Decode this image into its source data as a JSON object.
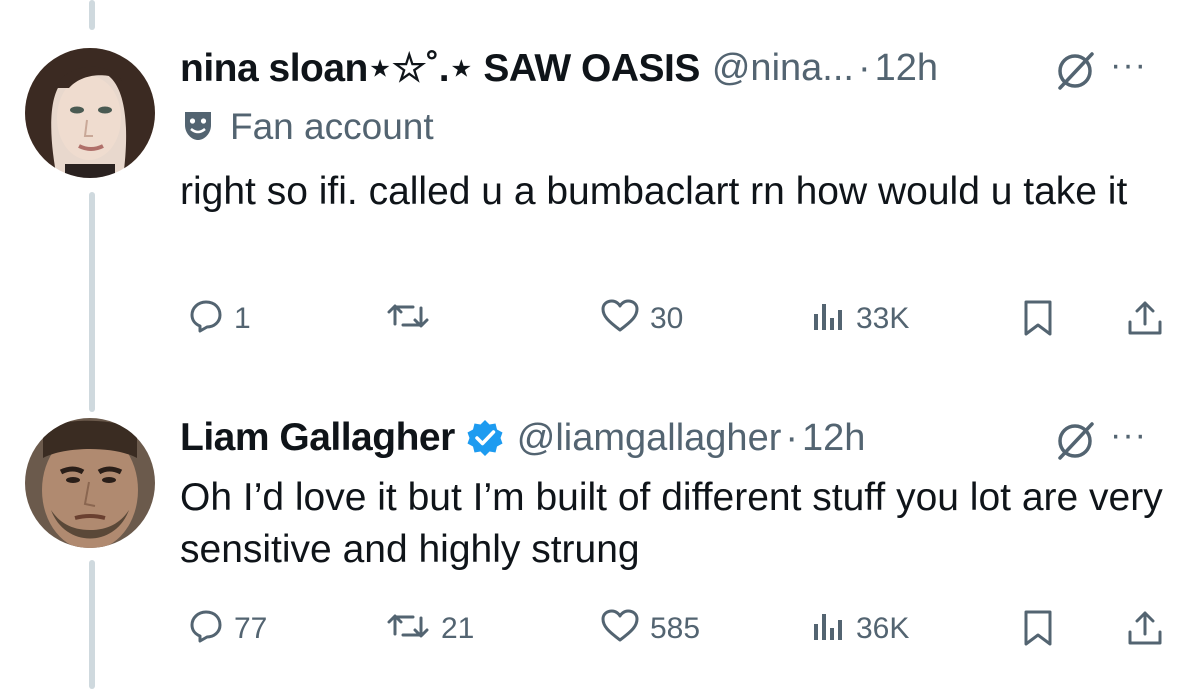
{
  "tweets": [
    {
      "name": "nina sloan⋆☆˚.⋆ SAW OASIS",
      "handle": "@nina...",
      "dot": "·",
      "time": "12h",
      "label": "Fan account",
      "text": "right so ifi. called u a bumbaclart rn how would u take it",
      "replies": "1",
      "reposts": "",
      "likes": "30",
      "views": "33K",
      "more": "···"
    },
    {
      "name": "Liam Gallagher",
      "handle": "@liamgallagher",
      "dot": "·",
      "time": "12h",
      "text": "Oh I’d love it but I’m built of different stuff you lot are very sensitive and highly strung",
      "replies": "77",
      "reposts": "21",
      "likes": "585",
      "views": "36K",
      "more": "···"
    }
  ],
  "colors": {
    "verified": "#1d9bf0",
    "muted": "#536471",
    "thread": "#cfd9de"
  }
}
